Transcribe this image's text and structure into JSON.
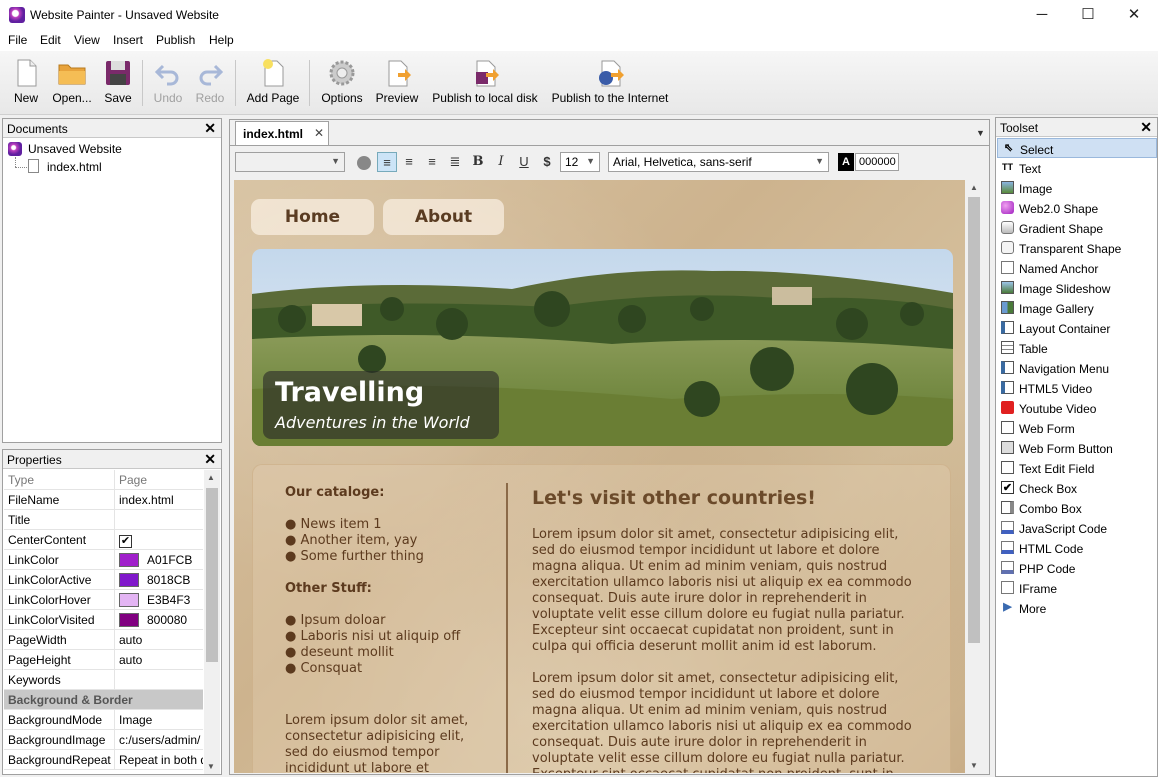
{
  "window": {
    "title": "Website Painter - Unsaved Website",
    "minimize": "─",
    "maximize": "☐",
    "close": "✕"
  },
  "menu": [
    "File",
    "Edit",
    "View",
    "Insert",
    "Publish",
    "Help"
  ],
  "toolbar": {
    "new": "New",
    "open": "Open...",
    "save": "Save",
    "undo": "Undo",
    "redo": "Redo",
    "add_page": "Add Page",
    "options": "Options",
    "preview": "Preview",
    "publish_local": "Publish to local disk",
    "publish_internet": "Publish to the Internet"
  },
  "documents": {
    "title": "Documents",
    "close": "✕",
    "root": "Unsaved Website",
    "file": "index.html"
  },
  "properties": {
    "title": "Properties",
    "close": "✕",
    "header": {
      "k": "Type",
      "v": "Page"
    },
    "rows": [
      {
        "k": "FileName",
        "v": "index.html"
      },
      {
        "k": "Title",
        "v": ""
      },
      {
        "k": "CenterContent",
        "v": "✔"
      },
      {
        "k": "LinkColor",
        "v": "A01FCB",
        "color": "#A01FCB"
      },
      {
        "k": "LinkColorActive",
        "v": "8018CB",
        "color": "#8018CB"
      },
      {
        "k": "LinkColorHover",
        "v": "E3B4F3",
        "color": "#E3B4F3"
      },
      {
        "k": "LinkColorVisited",
        "v": "800080",
        "color": "#800080"
      },
      {
        "k": "PageWidth",
        "v": "auto"
      },
      {
        "k": "PageHeight",
        "v": "auto"
      },
      {
        "k": "Keywords",
        "v": ""
      }
    ],
    "group": "Background & Border",
    "rows2": [
      {
        "k": "BackgroundMode",
        "v": "Image"
      },
      {
        "k": "BackgroundImage",
        "v": "c:/users/admin/"
      },
      {
        "k": "BackgroundRepeat",
        "v": "Repeat in both d"
      }
    ]
  },
  "editor": {
    "tab": "index.html",
    "tab_close": "✕",
    "font_size": "12",
    "font_family": "Arial, Helvetica, sans-serif",
    "color_label": "A",
    "color_value": "000000"
  },
  "site": {
    "nav": [
      "Home",
      "About"
    ],
    "hero_title": "Travelling",
    "hero_subtitle": "Adventures in the World",
    "catalog_head": "Our cataloge:",
    "catalog_items": [
      "● News item 1",
      "● Another item, yay",
      "● Some further thing"
    ],
    "other_head": "Other Stuff:",
    "other_items": [
      "● Ipsum doloar",
      "● Laboris nisi ut aliquip off",
      "● deseunt mollit",
      "● Consquat"
    ],
    "side_lorem": "Lorem ipsum dolor sit amet, consectetur adipisicing elit, sed do eiusmod tempor incididunt ut labore et",
    "main_head": "Let's visit other countries!",
    "main_p1": "Lorem ipsum dolor sit amet, consectetur adipisicing elit, sed do eiusmod tempor incididunt ut labore et dolore magna aliqua. Ut enim ad minim veniam, quis nostrud exercitation ullamco laboris nisi ut aliquip ex ea commodo consequat. Duis aute irure dolor in reprehenderit in voluptate velit esse cillum dolore eu fugiat nulla pariatur. Excepteur sint occaecat cupidatat non proident, sunt in culpa qui officia deserunt mollit anim id est laborum.",
    "main_p2": "Lorem ipsum dolor sit amet, consectetur adipisicing elit, sed do eiusmod tempor incididunt ut labore et dolore magna aliqua. Ut enim ad minim veniam, quis nostrud exercitation ullamco laboris nisi ut aliquip ex ea commodo consequat. Duis aute irure dolor in reprehenderit in voluptate velit esse cillum dolore eu fugiat nulla pariatur. Excepteur sint occaecat cupidatat non proident, sunt in"
  },
  "toolset": {
    "title": "Toolset",
    "close": "✕",
    "items": [
      {
        "label": "Select",
        "icon": "pointer-icon"
      },
      {
        "label": "Text",
        "icon": "text-icon"
      },
      {
        "label": "Image",
        "icon": "image-icon"
      },
      {
        "label": "Web2.0 Shape",
        "icon": "web20-shape-icon"
      },
      {
        "label": "Gradient Shape",
        "icon": "gradient-shape-icon"
      },
      {
        "label": "Transparent Shape",
        "icon": "transparent-shape-icon"
      },
      {
        "label": "Named Anchor",
        "icon": "anchor-icon"
      },
      {
        "label": "Image Slideshow",
        "icon": "slideshow-icon"
      },
      {
        "label": "Image Gallery",
        "icon": "gallery-icon"
      },
      {
        "label": "Layout Container",
        "icon": "layout-container-icon"
      },
      {
        "label": "Table",
        "icon": "table-icon"
      },
      {
        "label": "Navigation Menu",
        "icon": "navigation-menu-icon"
      },
      {
        "label": "HTML5 Video",
        "icon": "video-icon"
      },
      {
        "label": "Youtube Video",
        "icon": "youtube-icon"
      },
      {
        "label": "Web Form",
        "icon": "web-form-icon"
      },
      {
        "label": "Web Form Button",
        "icon": "form-button-icon"
      },
      {
        "label": "Text Edit Field",
        "icon": "text-field-icon"
      },
      {
        "label": "Check Box",
        "icon": "checkbox-icon"
      },
      {
        "label": "Combo Box",
        "icon": "combobox-icon"
      },
      {
        "label": "JavaScript Code",
        "icon": "javascript-icon"
      },
      {
        "label": "HTML Code",
        "icon": "html-code-icon"
      },
      {
        "label": "PHP Code",
        "icon": "php-code-icon"
      },
      {
        "label": "IFrame",
        "icon": "iframe-icon"
      },
      {
        "label": "More",
        "icon": "expand-icon"
      }
    ]
  }
}
